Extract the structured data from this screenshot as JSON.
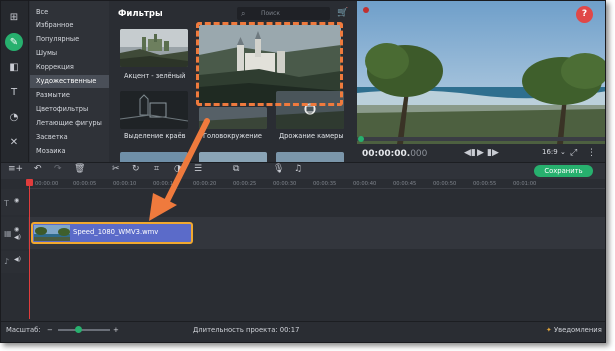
{
  "sidebar": {
    "tools": [
      "import-icon",
      "filters-icon",
      "transitions-icon",
      "titles-icon",
      "stickers-icon",
      "more-tools-icon"
    ],
    "categories": [
      "Все",
      "Избранное",
      "Популярные",
      "Шумы",
      "Коррекция",
      "Художественные",
      "Размытие",
      "Цветофильтры",
      "Летающие фигуры",
      "Засветка",
      "Мозаика"
    ],
    "selected_category": "Художественные"
  },
  "filters": {
    "title": "Фильтры",
    "search_placeholder": "Поиск",
    "items": [
      {
        "label": "Акцент - зелёный"
      },
      {
        "label": ""
      },
      {
        "label": "Выделение краёв"
      },
      {
        "label": "Головокружение"
      },
      {
        "label": "Дрожание камеры"
      }
    ]
  },
  "preview": {
    "timecode_main": "00:00:00.",
    "timecode_frac": "000",
    "aspect_ratio": "16:9 ⌄",
    "help": "?"
  },
  "toolbar": {
    "save_label": "Сохранить"
  },
  "timeline": {
    "ticks": [
      "00:00:00",
      "00:00:05",
      "00:00:10",
      "00:00:15",
      "00:00:20",
      "00:00:25",
      "00:00:30",
      "00:00:35",
      "00:00:40",
      "00:00:45",
      "00:00:50",
      "00:00:55",
      "00:01:00"
    ],
    "clip_name": "Speed_1080_WMV3.wmv"
  },
  "status": {
    "zoom_label": "Масштаб:",
    "zoom_level": 0.4,
    "duration_label": "Длительность проекта: 00:17",
    "notifications_label": "Уведомления"
  },
  "colors": {
    "accent": "#27b06e",
    "highlight": "#ef7a3d",
    "clip": "#5b6bc9",
    "clip_border": "#f1a92f"
  }
}
